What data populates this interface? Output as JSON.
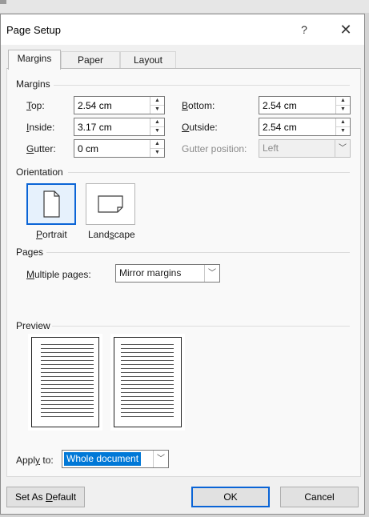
{
  "dialog": {
    "title": "Page Setup",
    "help_glyph": "?",
    "close_glyph": "✕"
  },
  "tabs": [
    {
      "label": "Margins",
      "active": true
    },
    {
      "label": "Paper",
      "active": false
    },
    {
      "label": "Layout",
      "active": false
    }
  ],
  "margins": {
    "section_title": "Margins",
    "top": {
      "key": "T",
      "rest": "op:",
      "value": "2.54 cm"
    },
    "bottom": {
      "key": "B",
      "rest": "ottom:",
      "value": "2.54 cm"
    },
    "inside": {
      "key": "I",
      "rest": "nside:",
      "value": "3.17 cm"
    },
    "outside": {
      "key": "O",
      "rest": "utside:",
      "value": "2.54 cm"
    },
    "gutter": {
      "key": "G",
      "rest": "utter:",
      "value": "0 cm"
    },
    "gutter_position": {
      "label": "Gutter position:",
      "value": "Left",
      "disabled": true
    }
  },
  "orientation": {
    "section_title": "Orientation",
    "portrait": {
      "key": "P",
      "rest": "ortrait",
      "selected": true
    },
    "landscape": {
      "pre": "Land",
      "key": "s",
      "rest": "cape",
      "selected": false
    }
  },
  "pages": {
    "section_title": "Pages",
    "multiple_pages": {
      "key": "M",
      "rest": "ultiple pages:",
      "value": "Mirror margins"
    }
  },
  "preview": {
    "section_title": "Preview"
  },
  "apply_to": {
    "pre": "Appl",
    "key": "y",
    "rest": " to:",
    "value": "Whole document"
  },
  "buttons": {
    "set_default": {
      "pre": "Set As ",
      "key": "D",
      "rest": "efault"
    },
    "ok": "OK",
    "cancel": "Cancel"
  },
  "colors": {
    "accent": "#0a64d6",
    "selection_bg": "#0078d7",
    "dialog_bg": "#f0f0f0",
    "panel_bg": "#f9f9f9"
  },
  "icons": {
    "help": "question-mark-icon",
    "close": "close-icon",
    "spin": "spin-arrows-icon",
    "dropdown": "chevron-down-icon",
    "portrait": "portrait-page-icon",
    "landscape": "landscape-page-icon"
  }
}
